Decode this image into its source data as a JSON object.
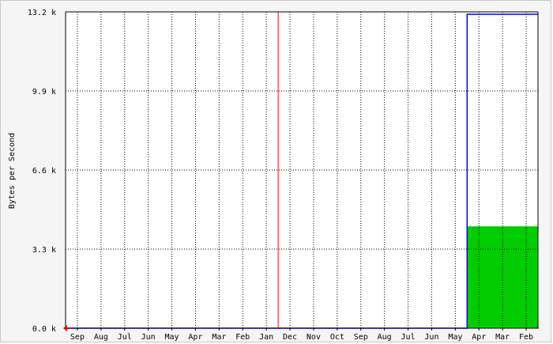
{
  "chart_data": {
    "type": "area",
    "ylabel": "Bytes per Second",
    "yticks": [
      "0.0 k",
      "3.3 k",
      "6.6 k",
      "9.9 k",
      "13.2 k"
    ],
    "ylim": [
      0,
      13.2
    ],
    "y_unit": "k",
    "categories": [
      "Sep",
      "Aug",
      "Jul",
      "Jun",
      "May",
      "Apr",
      "Mar",
      "Feb",
      "Jan",
      "Dec",
      "Nov",
      "Oct",
      "Sep",
      "Aug",
      "Jul",
      "Jun",
      "May",
      "Apr",
      "Mar",
      "Feb"
    ],
    "series": [
      {
        "role": "incoming-traffic-area",
        "color": "#00cc00",
        "values": [
          0,
          0,
          0,
          0,
          0,
          0,
          0,
          0,
          0,
          0,
          0,
          0,
          0,
          0,
          0,
          0,
          0,
          4.25,
          4.25,
          4.25
        ]
      },
      {
        "role": "outgoing-traffic-line",
        "color": "#0000ff",
        "values": [
          0,
          0,
          0,
          0,
          0,
          0,
          0,
          0,
          0,
          0,
          0,
          0,
          0,
          0,
          0,
          0,
          0,
          13.1,
          13.1,
          13.1
        ]
      }
    ],
    "year_divider_after": "Jan",
    "year_divider_color": "#ff0000",
    "grid": true,
    "background": "#f5f5f5",
    "plot_background": "#ffffff",
    "gridline_color": "#000000",
    "origin_marker_color": "#ff0000"
  }
}
